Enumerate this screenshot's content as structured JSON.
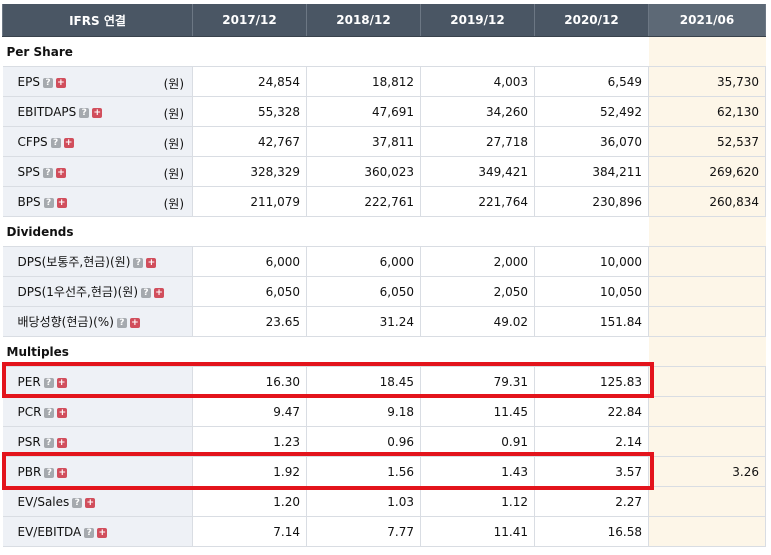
{
  "header": {
    "title": "IFRS 연결",
    "periods": [
      "2017/12",
      "2018/12",
      "2019/12",
      "2020/12",
      "2021/06"
    ]
  },
  "sections": {
    "per_share": "Per Share",
    "dividends": "Dividends",
    "multiples": "Multiples"
  },
  "unit": "(원)",
  "rows": {
    "eps": {
      "label": "EPS",
      "values": [
        "24,854",
        "18,812",
        "4,003",
        "6,549",
        "35,730"
      ]
    },
    "ebitdaps": {
      "label": "EBITDAPS",
      "values": [
        "55,328",
        "47,691",
        "34,260",
        "52,492",
        "62,130"
      ]
    },
    "cfps": {
      "label": "CFPS",
      "values": [
        "42,767",
        "37,811",
        "27,718",
        "36,070",
        "52,537"
      ]
    },
    "sps": {
      "label": "SPS",
      "values": [
        "328,329",
        "360,023",
        "349,421",
        "384,211",
        "269,620"
      ]
    },
    "bps": {
      "label": "BPS",
      "values": [
        "211,079",
        "222,761",
        "221,764",
        "230,896",
        "260,834"
      ]
    },
    "dps_common": {
      "label": "DPS(보통주,현금)(원)",
      "values": [
        "6,000",
        "6,000",
        "2,000",
        "10,000",
        ""
      ]
    },
    "dps_pref": {
      "label": "DPS(1우선주,현금)(원)",
      "values": [
        "6,050",
        "6,050",
        "2,050",
        "10,050",
        ""
      ]
    },
    "payout": {
      "label": "배당성향(현금)(%)",
      "values": [
        "23.65",
        "31.24",
        "49.02",
        "151.84",
        ""
      ]
    },
    "per": {
      "label": "PER",
      "values": [
        "16.30",
        "18.45",
        "79.31",
        "125.83",
        ""
      ]
    },
    "pcr": {
      "label": "PCR",
      "values": [
        "9.47",
        "9.18",
        "11.45",
        "22.84",
        ""
      ]
    },
    "psr": {
      "label": "PSR",
      "values": [
        "1.23",
        "0.96",
        "0.91",
        "2.14",
        ""
      ]
    },
    "pbr": {
      "label": "PBR",
      "values": [
        "1.92",
        "1.56",
        "1.43",
        "3.57",
        "3.26"
      ]
    },
    "ev_sales": {
      "label": "EV/Sales",
      "values": [
        "1.20",
        "1.03",
        "1.12",
        "2.27",
        ""
      ]
    },
    "ev_ebitda": {
      "label": "EV/EBITDA",
      "values": [
        "7.14",
        "7.77",
        "11.41",
        "16.58",
        ""
      ]
    }
  },
  "icons": {
    "help": "question-icon",
    "expand": "plus-icon"
  },
  "colors": {
    "header_bg": "#4a5664",
    "label_bg": "#eef1f6",
    "latest_bg": "#fdf6e8",
    "highlight_border": "#e3141c"
  }
}
